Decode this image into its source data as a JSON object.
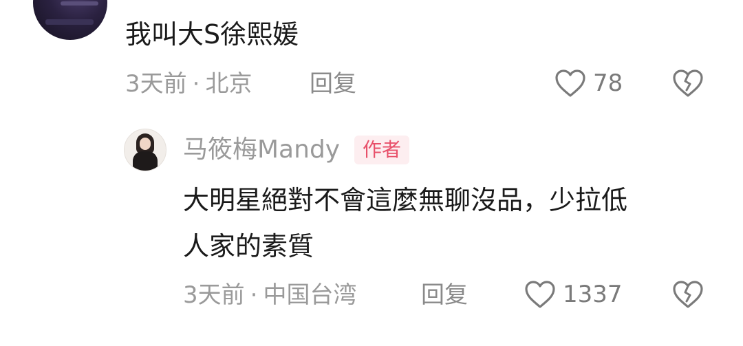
{
  "comment1": {
    "text": "我叫大S徐熙媛",
    "time": "3天前",
    "location": "北京",
    "reply_label": "回复",
    "like_count": "78"
  },
  "reply": {
    "author": "马筱梅Mandy",
    "badge": "作者",
    "text_line1": "大明星絕對不會這麼無聊沒品，少拉低",
    "text_line2": "人家的素質",
    "time": "3天前",
    "location": "中国台湾",
    "reply_label": "回复",
    "like_count": "1337"
  },
  "icons": {
    "like": "heart-outline-icon",
    "dislike": "broken-heart-icon"
  },
  "colors": {
    "badge_text": "#e8506a",
    "badge_bg": "#fdeef0",
    "meta_text": "#9a9a9a"
  }
}
